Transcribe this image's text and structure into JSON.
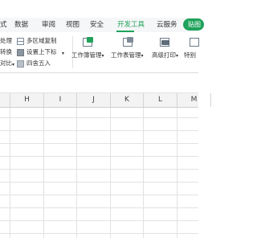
{
  "tabs": [
    "式",
    "数据",
    "审阅",
    "视图",
    "安全",
    "开发工具",
    "云服务"
  ],
  "active_tab": "开发工具",
  "badge": "贴图",
  "ribbon": {
    "left_cut": {
      "row1": "处理",
      "row2": "转换",
      "row3": "对比"
    },
    "multi_area_copy": "多区域复制",
    "set_up_down_label": "设置上下标",
    "round_label": "四舍五入",
    "workbook_manage": "工作簿管理",
    "worksheet_manage": "工作表管理",
    "advanced_print": "高级打印",
    "special": "特别"
  },
  "columns": [
    "H",
    "I",
    "J",
    "K",
    "L",
    "M"
  ],
  "accent_color": "#1fa25a"
}
